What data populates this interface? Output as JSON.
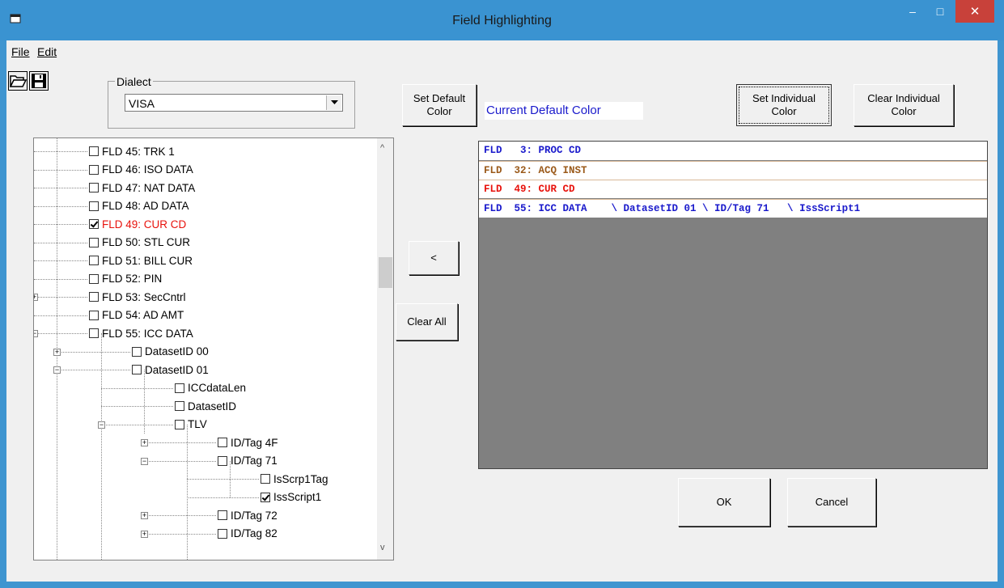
{
  "window": {
    "title": "Field Highlighting",
    "minimize": "–",
    "maximize": "□",
    "close": "✕"
  },
  "menu": {
    "file": "File",
    "edit": "Edit"
  },
  "toolbar": {
    "open_icon": "folder-open-icon",
    "save_icon": "floppy-disk-icon"
  },
  "dialect": {
    "legend": "Dialect",
    "value": "VISA"
  },
  "buttons": {
    "set_default": "Set Default Color",
    "set_default_l1": "Set Default",
    "set_default_l2": "Color",
    "set_individual_l1": "Set Individual",
    "set_individual_l2": "Color",
    "clear_individual_l1": "Clear Individual",
    "clear_individual_l2": "Color",
    "move_left": "<",
    "clear_all": "Clear All",
    "ok": "OK",
    "cancel": "Cancel"
  },
  "current_default_color": {
    "label": "Current Default Color",
    "color": "#1a1acc"
  },
  "tree": {
    "items": [
      {
        "label": "FLD  45: TRK 1",
        "checked": false,
        "color": "#000000"
      },
      {
        "label": "FLD  46: ISO DATA",
        "checked": false,
        "color": "#000000"
      },
      {
        "label": "FLD  47: NAT DATA",
        "checked": false,
        "color": "#000000"
      },
      {
        "label": "FLD  48: AD DATA",
        "checked": false,
        "color": "#000000"
      },
      {
        "label": "FLD  49: CUR CD",
        "checked": true,
        "color": "#e8120c"
      },
      {
        "label": "FLD  50: STL CUR",
        "checked": false,
        "color": "#000000"
      },
      {
        "label": "FLD  51: BILL CUR",
        "checked": false,
        "color": "#000000"
      },
      {
        "label": "FLD  52: PIN",
        "checked": false,
        "color": "#000000"
      },
      {
        "label": "FLD  53: SecCntrl",
        "checked": false,
        "color": "#000000",
        "expander": "+"
      },
      {
        "label": "FLD  54: AD AMT",
        "checked": false,
        "color": "#000000"
      },
      {
        "label": "FLD  55: ICC DATA",
        "checked": false,
        "color": "#000000",
        "expander": "−"
      },
      {
        "label": "DatasetID 00",
        "checked": false,
        "color": "#000000",
        "expander": "+"
      },
      {
        "label": "DatasetID 01",
        "checked": false,
        "color": "#000000",
        "expander": "−"
      },
      {
        "label": "ICCdataLen",
        "checked": false,
        "color": "#000000"
      },
      {
        "label": "DatasetID",
        "checked": false,
        "color": "#000000"
      },
      {
        "label": "TLV",
        "checked": false,
        "color": "#000000",
        "expander": "−"
      },
      {
        "label": "ID/Tag 4F",
        "checked": false,
        "color": "#000000",
        "expander": "+"
      },
      {
        "label": "ID/Tag 71",
        "checked": false,
        "color": "#000000",
        "expander": "−"
      },
      {
        "label": "IsScrp1Tag",
        "checked": false,
        "color": "#000000"
      },
      {
        "label": "IssScript1",
        "checked": true,
        "color": "#000000"
      },
      {
        "label": "ID/Tag 72",
        "checked": false,
        "color": "#000000",
        "expander": "+"
      },
      {
        "label": "ID/Tag 82",
        "checked": false,
        "color": "#000000",
        "expander": "+"
      }
    ],
    "scroll_up": "^",
    "scroll_down": "v"
  },
  "selected_fields": {
    "rows": [
      {
        "text": "FLD   3: PROC CD",
        "color": "#1a1acc"
      },
      {
        "text": "FLD  32: ACQ INST",
        "color": "#9b5a1a"
      },
      {
        "text": "FLD  49: CUR CD",
        "color": "#e8120c"
      },
      {
        "text": "FLD  55: ICC DATA    \\ DatasetID 01 \\ ID/Tag 71   \\ IssScript1",
        "color": "#1a1acc"
      }
    ]
  }
}
